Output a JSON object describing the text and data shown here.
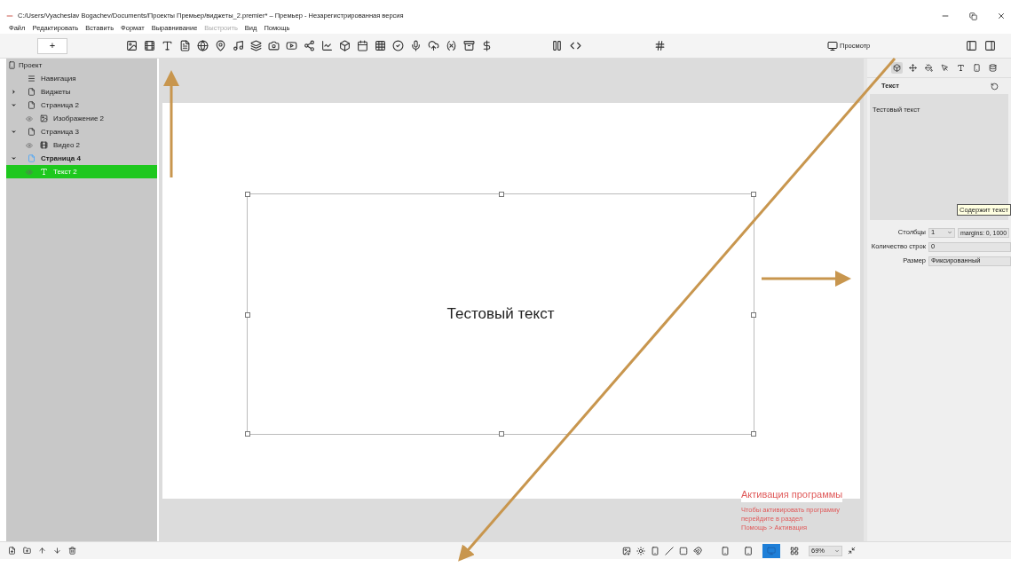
{
  "window": {
    "title": "C:/Users/Vyacheslav Bogachev/Documents/Проекты Премьер/виджеты_2.premier* – Премьер - Незарегистрированная версия"
  },
  "menu": [
    {
      "label": "Файл",
      "disabled": false
    },
    {
      "label": "Редактировать",
      "disabled": false
    },
    {
      "label": "Вставить",
      "disabled": false
    },
    {
      "label": "Формат",
      "disabled": false
    },
    {
      "label": "Выравнивание",
      "disabled": false
    },
    {
      "label": "Выстроить",
      "disabled": true
    },
    {
      "label": "Вид",
      "disabled": false
    },
    {
      "label": "Помощь",
      "disabled": false
    }
  ],
  "toolbar": {
    "add_button": "+",
    "preview_button": "Просмотр"
  },
  "tree": {
    "label": "Проект",
    "children": [
      {
        "label": "Навигация",
        "kind": "nav",
        "current": false,
        "selected": false
      },
      {
        "label": "Виджеты",
        "kind": "page",
        "expanded": false,
        "current": false,
        "selected": false
      },
      {
        "label": "Страница 2",
        "kind": "page",
        "expanded": true,
        "current": false,
        "selected": false,
        "children": [
          {
            "label": "Изображение 2",
            "kind": "image",
            "visible": true,
            "selected": false
          }
        ]
      },
      {
        "label": "Страница 3",
        "kind": "page",
        "expanded": true,
        "current": false,
        "selected": false,
        "children": [
          {
            "label": "Видео 2",
            "kind": "video",
            "visible": true,
            "selected": false
          }
        ]
      },
      {
        "label": "Страница 4",
        "kind": "page",
        "expanded": true,
        "current": true,
        "selected": false,
        "children": [
          {
            "label": "Текст 2",
            "kind": "text",
            "visible": true,
            "selected": true
          }
        ]
      }
    ]
  },
  "canvas": {
    "text": "Тестовый текст"
  },
  "activation": {
    "title": "Активация программы",
    "lines": [
      "Чтобы активировать программу",
      "перейдите в раздел",
      "Помощь > Активация"
    ]
  },
  "inspector": {
    "tabs": [
      {
        "kind": "widget",
        "selected": true
      },
      {
        "kind": "move",
        "selected": false
      },
      {
        "kind": "fill",
        "selected": false
      },
      {
        "kind": "pointer",
        "selected": false
      },
      {
        "kind": "text",
        "selected": false
      },
      {
        "kind": "device",
        "selected": false
      },
      {
        "kind": "data",
        "selected": false
      }
    ],
    "section": "Текст",
    "text_value": "Тестовый текст",
    "tooltip": "Содержит текст",
    "fields": [
      {
        "label": "Столбцы",
        "value": "1",
        "kind": "spin",
        "extra": "margins: 0, 1000"
      },
      {
        "label": "Количество строк",
        "value": "0",
        "kind": "input"
      },
      {
        "label": "Размер",
        "value": "Фиксированный",
        "kind": "input"
      }
    ]
  },
  "view_modes": [
    {
      "kind": "phone",
      "selected": false
    },
    {
      "kind": "tablet",
      "selected": false
    },
    {
      "kind": "desktop",
      "selected": true
    },
    {
      "kind": "windows",
      "selected": false
    }
  ],
  "zoom": "69%"
}
